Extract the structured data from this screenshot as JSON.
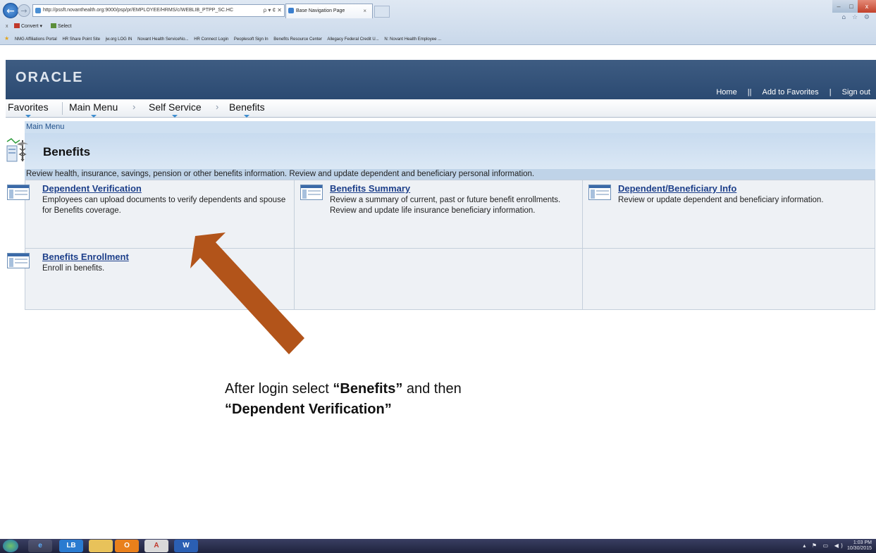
{
  "browser": {
    "url": "http://pssft.novanthealth.org:9000/psp/pr/EMPLOYEE/HRMS/c/WEBLIB_PTPP_SC.HC",
    "addr_tools": "ρ ▾ ¢ ✕",
    "tab_title": "Base Navigation Page",
    "tab_close": "×",
    "back_icon": "←",
    "forward_icon": "→",
    "right_icons": "⌂ ☆ ⚙",
    "min_glyph": "–",
    "max_glyph": "□",
    "close_glyph": "x",
    "command_bar": {
      "close": "x",
      "convert": "Convert",
      "convert_caret": "▾",
      "select": "Select"
    },
    "favorites": [
      "NMG Affiliations Portal",
      "HR Share Point Site",
      "jw.org LOG IN",
      "Novant Health ServiceNo...",
      "HR Connect Login",
      "Peoplesoft Sign In",
      "Benefits Resource Center",
      "Allegacy Federal Credit U...",
      "N: Novant Health Employee ..."
    ]
  },
  "header": {
    "logo": "ORACLE",
    "links": {
      "home": "Home",
      "add_favorites": "Add to Favorites",
      "sign_out": "Sign out"
    },
    "sep1": "||",
    "sep2": "|"
  },
  "nav": {
    "favorites": "Favorites",
    "main_menu": "Main Menu",
    "self_service": "Self Service",
    "benefits": "Benefits",
    "chevron": "›"
  },
  "page": {
    "breadcrumb": "Main Menu",
    "title": "Benefits",
    "description": "Review health, insurance, savings, pension or other benefits information. Review and update dependent and beneficiary personal information.",
    "items": [
      {
        "label": "Dependent Verification",
        "desc": "Employees can upload documents to verify dependents and spouse for Benefits coverage."
      },
      {
        "label": "Benefits Summary",
        "desc": "Review a summary of current, past or future benefit enrollments. Review and update life insurance beneficiary information."
      },
      {
        "label": "Dependent/Beneficiary Info",
        "desc": "Review or update dependent and beneficiary information."
      },
      {
        "label": "Benefits Enrollment",
        "desc": "Enroll in benefits."
      }
    ]
  },
  "annotation": {
    "line1_prefix": "After login select ",
    "line1_bold": "“Benefits”",
    "line1_suffix": " and then",
    "line2_bold": "“Dependent Verification”",
    "arrow_color": "#b2541a"
  },
  "taskbar": {
    "apps": [
      "start-orb",
      "internet-explorer",
      "lb-app",
      "file-explorer",
      "outlook",
      "acrobat",
      "word"
    ],
    "labels": {
      "lb": "LB",
      "outlook": "O",
      "pdf": "A",
      "word": "W"
    },
    "tray_icons": "▴ ⚑ ▭ ◀)",
    "time": "1:03 PM",
    "date": "10/30/2015"
  }
}
